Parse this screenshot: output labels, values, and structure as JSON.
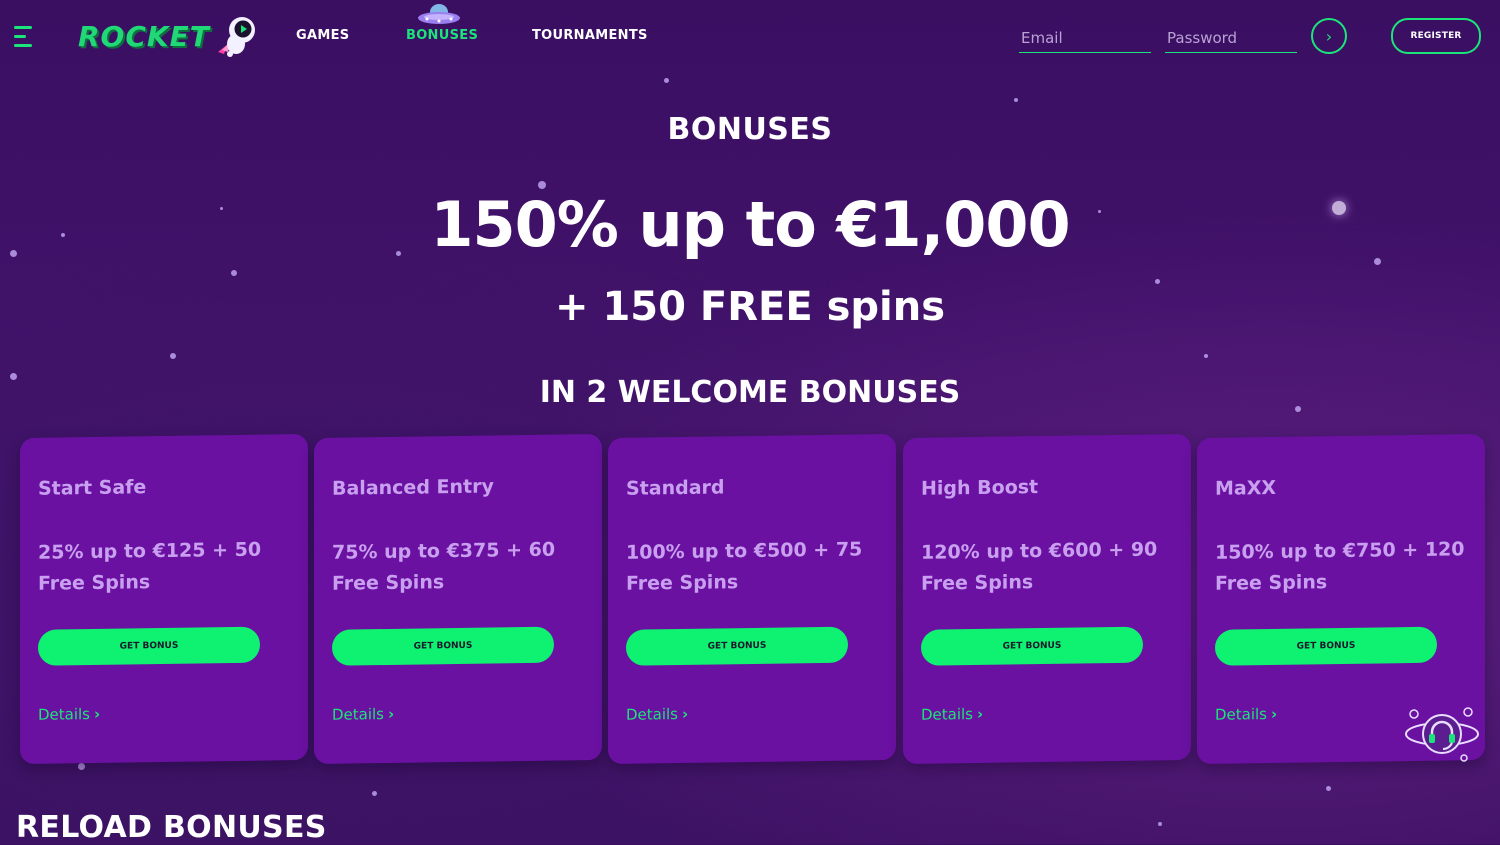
{
  "header": {
    "logo_text": "ROCKET",
    "nav": {
      "games": "GAMES",
      "bonuses": "BONUSES",
      "tournaments": "TOURNAMENTS"
    },
    "email_placeholder": "Email",
    "password_placeholder": "Password",
    "login_arrow": "›",
    "register_label": "REGISTER"
  },
  "hero": {
    "page_title": "BONUSES",
    "main_offer": "150% up to €1,000",
    "sub_offer": "+ 150 FREE spins",
    "welcome_heading": "IN 2 WELCOME BONUSES"
  },
  "cards": [
    {
      "title": "Start Safe",
      "desc": "25% up to €125 + 50 Free Spins",
      "button": "GET BONUS",
      "details": "Details",
      "chevron": "›"
    },
    {
      "title": "Balanced Entry",
      "desc": "75% up to €375 + 60 Free Spins",
      "button": "GET BONUS",
      "details": "Details",
      "chevron": "›"
    },
    {
      "title": "Standard",
      "desc": "100% up to €500 + 75 Free Spins",
      "button": "GET BONUS",
      "details": "Details",
      "chevron": "›"
    },
    {
      "title": "High Boost",
      "desc": "120% up to €600 + 90 Free Spins",
      "button": "GET BONUS",
      "details": "Details",
      "chevron": "›"
    },
    {
      "title": "MaXX",
      "desc": "150% up to €750 + 120 Free Spins",
      "button": "GET BONUS",
      "details": "Details",
      "chevron": "›"
    }
  ],
  "reload_heading": "RELOAD BONUSES",
  "colors": {
    "accent_green": "#1be579",
    "button_green": "#0ff170",
    "card_purple": "#6a11a2",
    "card_text": "#c9a0ef",
    "background": "#3c1062"
  },
  "icons": [
    "menu-icon",
    "astronaut-icon",
    "ufo-icon",
    "arrow-right-icon",
    "support-headset-icon",
    "chevron-right-icon"
  ]
}
